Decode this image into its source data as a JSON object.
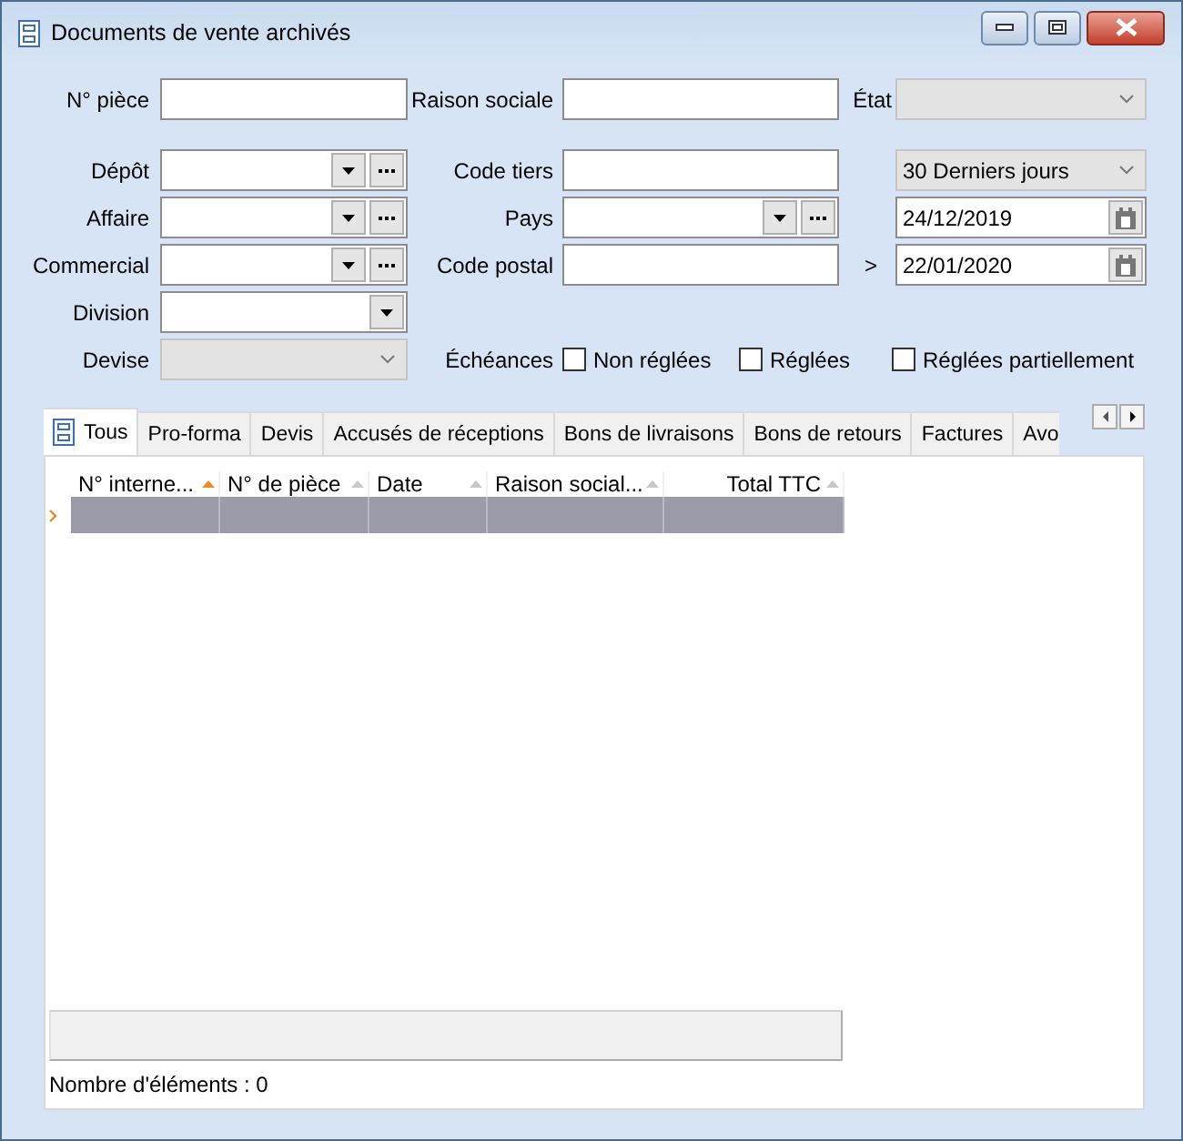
{
  "window": {
    "title": "Documents de vente archivés"
  },
  "left_fields": [
    {
      "label": "N° pièce",
      "kind": "text"
    },
    {
      "label": "Dépôt",
      "kind": "lookup"
    },
    {
      "label": "Affaire",
      "kind": "lookup"
    },
    {
      "label": "Commercial",
      "kind": "lookup"
    },
    {
      "label": "Division",
      "kind": "dropdown"
    },
    {
      "label": "Devise",
      "kind": "select",
      "disabled": true
    }
  ],
  "middle_fields": [
    {
      "label": "Raison sociale",
      "kind": "text"
    },
    {
      "label": "Code tiers",
      "kind": "text"
    },
    {
      "label": "Pays",
      "kind": "lookup"
    },
    {
      "label": "Code postal",
      "kind": "text"
    }
  ],
  "right_fields": [
    {
      "label": "État",
      "kind": "select",
      "disabled": true
    },
    {
      "kind": "select",
      "value": "30 Derniers jours",
      "disabled": true
    },
    {
      "kind": "date",
      "value": "24/12/2019"
    },
    {
      "label": ">",
      "kind": "date",
      "value": "22/01/2020"
    }
  ],
  "due_filter": {
    "label": "Échéances",
    "options": [
      {
        "label": "Non réglées",
        "checked": false
      },
      {
        "label": "Réglées",
        "checked": false
      },
      {
        "label": "Réglées partiellement",
        "checked": false
      }
    ]
  },
  "tabs": [
    {
      "label": "Tous",
      "selected": true
    },
    {
      "label": "Pro-forma",
      "selected": false
    },
    {
      "label": "Devis",
      "selected": false
    },
    {
      "label": "Accusés de réceptions",
      "selected": false
    },
    {
      "label": "Bons de livraisons",
      "selected": false
    },
    {
      "label": "Bons de retours",
      "selected": false
    },
    {
      "label": "Factures",
      "selected": false
    },
    {
      "label": "Avo",
      "selected": false
    }
  ],
  "table": {
    "columns": [
      {
        "label": "N° interne...",
        "sorted": true,
        "kind": "text"
      },
      {
        "label": "N° de pièce",
        "sorted": false,
        "kind": "text"
      },
      {
        "label": "Date",
        "sorted": false,
        "kind": "text"
      },
      {
        "label": "Raison social...",
        "sorted": false,
        "kind": "text"
      },
      {
        "label": "Total TTC",
        "sorted": false,
        "kind": "amount"
      }
    ],
    "rows": [
      {
        "current": true
      }
    ]
  },
  "status_bar": "Nombre d'éléments : 0"
}
